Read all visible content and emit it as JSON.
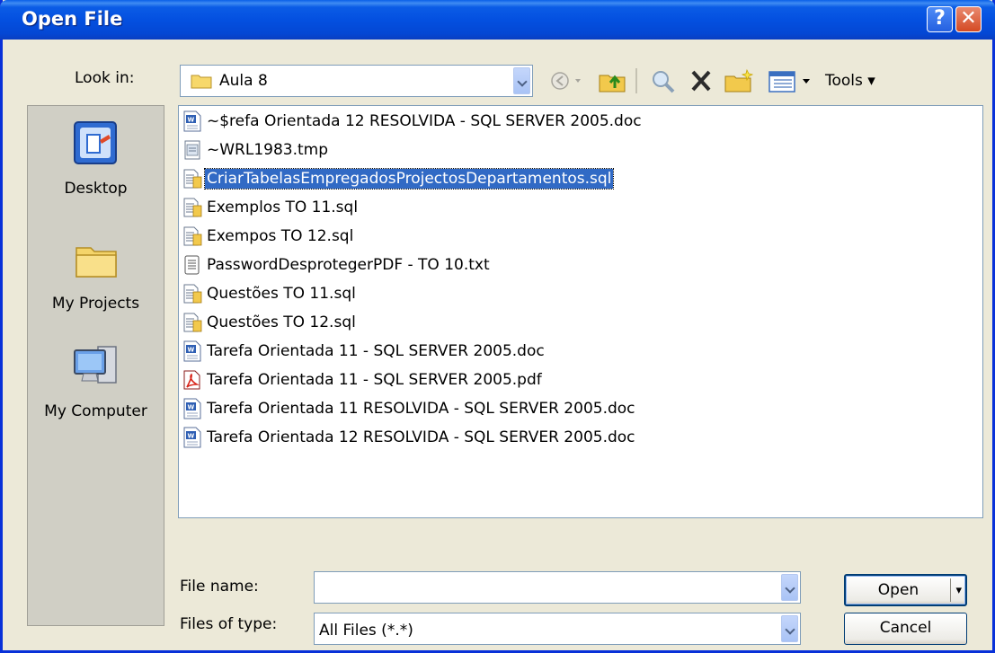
{
  "window": {
    "title": "Open File"
  },
  "lookin": {
    "label": "Look in:",
    "value": "Aula 8"
  },
  "toolbar": {
    "tools_label": "Tools"
  },
  "places": [
    {
      "label": "Desktop",
      "icon": "desktop-icon"
    },
    {
      "label": "My Projects",
      "icon": "folder-icon"
    },
    {
      "label": "My Computer",
      "icon": "computer-icon"
    }
  ],
  "files": [
    {
      "name": "~$refa Orientada 12 RESOLVIDA - SQL SERVER 2005.doc",
      "icon": "word-doc-icon"
    },
    {
      "name": "~WRL1983.tmp",
      "icon": "tmp-file-icon"
    },
    {
      "name": "CriarTabelasEmpregadosProjectosDepartamentos.sql",
      "icon": "sql-file-icon",
      "selected": true
    },
    {
      "name": "Exemplos TO 11.sql",
      "icon": "sql-file-icon"
    },
    {
      "name": "Exempos TO 12.sql",
      "icon": "sql-file-icon"
    },
    {
      "name": "PasswordDesprotegerPDF - TO 10.txt",
      "icon": "text-file-icon"
    },
    {
      "name": "Questões TO 11.sql",
      "icon": "sql-file-icon"
    },
    {
      "name": "Questões TO 12.sql",
      "icon": "sql-file-icon"
    },
    {
      "name": "Tarefa Orientada 11 - SQL SERVER 2005.doc",
      "icon": "word-doc-icon"
    },
    {
      "name": "Tarefa Orientada 11 - SQL SERVER 2005.pdf",
      "icon": "pdf-file-icon"
    },
    {
      "name": "Tarefa Orientada 11 RESOLVIDA - SQL SERVER 2005.doc",
      "icon": "word-doc-icon"
    },
    {
      "name": "Tarefa Orientada 12 RESOLVIDA - SQL SERVER 2005.doc",
      "icon": "word-doc-icon"
    }
  ],
  "filename": {
    "label": "File name:",
    "value": ""
  },
  "filetype": {
    "label": "Files of type:",
    "value": "All Files (*.*)"
  },
  "buttons": {
    "open": "Open",
    "cancel": "Cancel"
  },
  "colors": {
    "titlebar": "#0450e0",
    "selection": "#316ac5",
    "dialog_bg": "#ece9d8"
  }
}
